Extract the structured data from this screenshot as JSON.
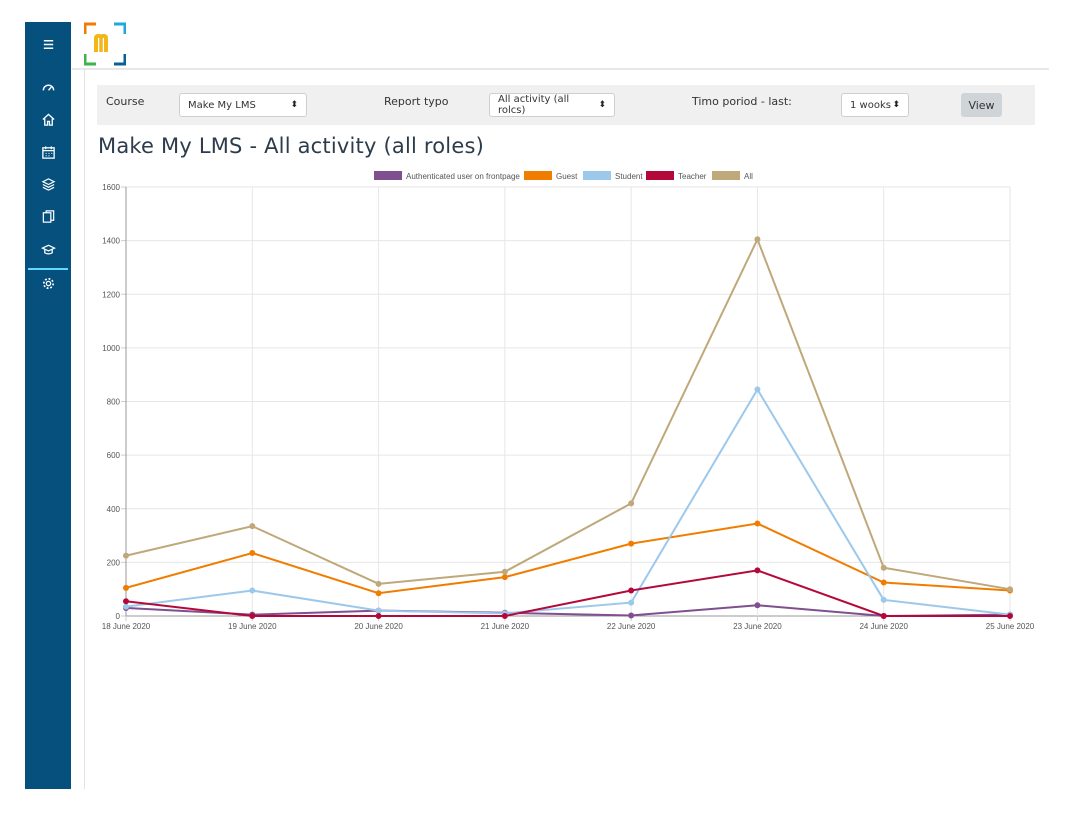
{
  "sidebar": {
    "items": [
      {
        "icon": "menu-icon"
      },
      {
        "icon": "dashboard-icon"
      },
      {
        "icon": "home-icon"
      },
      {
        "icon": "calendar-icon"
      },
      {
        "icon": "layers-icon"
      },
      {
        "icon": "files-icon"
      },
      {
        "icon": "graduation-cap-icon"
      },
      {
        "icon": "gear-icon"
      }
    ],
    "accent": "#67d6ff",
    "background": "#06507e"
  },
  "filters": {
    "course_label": "Course",
    "course_value": "Make My LMS",
    "report_type_label": "Report typo",
    "report_type_value": "All activity (all rolcs)",
    "time_period_label": "Timo poriod - last:",
    "time_period_value": "1 wooks",
    "view_button": "View"
  },
  "page": {
    "title": "Make My LMS - All activity (all roles)"
  },
  "chart_data": {
    "type": "line",
    "x": [
      "18 June 2020",
      "19 June 2020",
      "20 June 2020",
      "21 June 2020",
      "22 June 2020",
      "23 June 2020",
      "24 June 2020",
      "25 June 2020"
    ],
    "ylim": [
      0,
      1600
    ],
    "yticks": [
      "0",
      "200",
      "400",
      "600",
      "800",
      "1000",
      "1200",
      "1400",
      "1600"
    ],
    "grid": true,
    "legend": "top-center",
    "series": [
      {
        "name": "Authenticated user on frontpage",
        "color": "#7f4f8f",
        "values": [
          30,
          5,
          20,
          12,
          2,
          40,
          0,
          5
        ]
      },
      {
        "name": "Guest",
        "color": "#f07d00",
        "values": [
          105,
          235,
          85,
          145,
          270,
          345,
          125,
          95
        ]
      },
      {
        "name": "Student",
        "color": "#9cc8ec",
        "values": [
          35,
          95,
          20,
          10,
          50,
          845,
          60,
          5
        ]
      },
      {
        "name": "Teacher",
        "color": "#b5083a",
        "values": [
          55,
          0,
          0,
          0,
          95,
          170,
          0,
          0
        ]
      },
      {
        "name": "All",
        "color": "#bfa87a",
        "values": [
          225,
          335,
          120,
          165,
          420,
          1405,
          180,
          100
        ]
      }
    ]
  }
}
